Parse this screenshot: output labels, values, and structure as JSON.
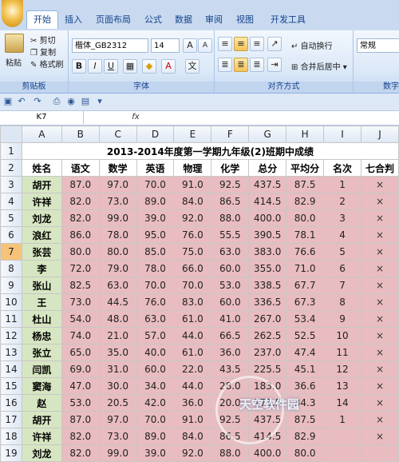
{
  "tabs": [
    "开始",
    "插入",
    "页面布局",
    "公式",
    "数据",
    "审阅",
    "视图",
    "开发工具"
  ],
  "clipboard": {
    "paste": "粘贴",
    "cut": "剪切",
    "copy": "复制",
    "format_painter": "格式刷",
    "label": "剪贴板"
  },
  "font": {
    "name": "楷体_GB2312",
    "size": "14",
    "label": "字体"
  },
  "align": {
    "wrap": "自动换行",
    "merge": "合并后居中",
    "label": "对齐方式"
  },
  "number": {
    "format": "常规",
    "label": "数字"
  },
  "formula_bar": {
    "cell_ref": "K7",
    "fx": "fx",
    "value": ""
  },
  "columns": [
    "A",
    "B",
    "C",
    "D",
    "E",
    "F",
    "G",
    "H",
    "I",
    "J"
  ],
  "sheet": {
    "title": "2013-2014年度第一学期九年级(2)班期中成绩",
    "headers": [
      "姓名",
      "语文",
      "数学",
      "英语",
      "物理",
      "化学",
      "总分",
      "平均分",
      "名次",
      "七合判"
    ],
    "rows": [
      [
        "胡开",
        "87.0",
        "97.0",
        "70.0",
        "91.0",
        "92.5",
        "437.5",
        "87.5",
        "1",
        "×"
      ],
      [
        "许祥",
        "82.0",
        "73.0",
        "89.0",
        "84.0",
        "86.5",
        "414.5",
        "82.9",
        "2",
        "×"
      ],
      [
        "刘龙",
        "82.0",
        "99.0",
        "39.0",
        "92.0",
        "88.0",
        "400.0",
        "80.0",
        "3",
        "×"
      ],
      [
        "浪红",
        "86.0",
        "78.0",
        "95.0",
        "76.0",
        "55.5",
        "390.5",
        "78.1",
        "4",
        "×"
      ],
      [
        "张芸",
        "80.0",
        "80.0",
        "85.0",
        "75.0",
        "63.0",
        "383.0",
        "76.6",
        "5",
        "×"
      ],
      [
        "李",
        "72.0",
        "79.0",
        "78.0",
        "66.0",
        "60.0",
        "355.0",
        "71.0",
        "6",
        "×"
      ],
      [
        "张山",
        "82.5",
        "63.0",
        "70.0",
        "70.0",
        "53.0",
        "338.5",
        "67.7",
        "7",
        "×"
      ],
      [
        "王",
        "73.0",
        "44.5",
        "76.0",
        "83.0",
        "60.0",
        "336.5",
        "67.3",
        "8",
        "×"
      ],
      [
        "杜山",
        "54.0",
        "48.0",
        "63.0",
        "61.0",
        "41.0",
        "267.0",
        "53.4",
        "9",
        "×"
      ],
      [
        "杨忠",
        "74.0",
        "21.0",
        "57.0",
        "44.0",
        "66.5",
        "262.5",
        "52.5",
        "10",
        "×"
      ],
      [
        "张立",
        "65.0",
        "35.0",
        "40.0",
        "61.0",
        "36.0",
        "237.0",
        "47.4",
        "11",
        "×"
      ],
      [
        "闫凯",
        "69.0",
        "31.0",
        "60.0",
        "22.0",
        "43.5",
        "225.5",
        "45.1",
        "12",
        "×"
      ],
      [
        "窦海",
        "47.0",
        "30.0",
        "34.0",
        "44.0",
        "28.0",
        "183.0",
        "36.6",
        "13",
        "×"
      ],
      [
        "赵",
        "53.0",
        "20.5",
        "42.0",
        "36.0",
        "20.0",
        "171.5",
        "34.3",
        "14",
        "×"
      ],
      [
        "胡开",
        "87.0",
        "97.0",
        "70.0",
        "91.0",
        "92.5",
        "437.5",
        "87.5",
        "1",
        "×"
      ],
      [
        "许祥",
        "82.0",
        "73.0",
        "89.0",
        "84.0",
        "86.5",
        "414.5",
        "82.9",
        "",
        "×"
      ],
      [
        "刘龙",
        "82.0",
        "99.0",
        "39.0",
        "92.0",
        "88.0",
        "400.0",
        "80.0",
        "",
        ""
      ]
    ]
  },
  "watermark": "天空软件园",
  "colors": {
    "name_fill": "#d7e6c2",
    "score_fill": "#e8bcc0",
    "selected_row": "#f7c37a"
  }
}
